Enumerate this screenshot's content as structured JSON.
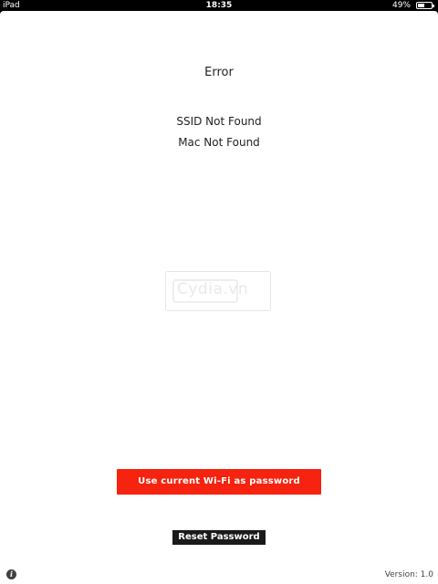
{
  "status_bar": {
    "carrier": "iPad",
    "time": "18:35",
    "battery_percent_label": "49%",
    "battery_level": 0.49
  },
  "main": {
    "title": "Error",
    "ssid_status": "SSID Not Found",
    "mac_status": "Mac Not Found"
  },
  "watermark": {
    "text": "Cydia.vn"
  },
  "buttons": {
    "use_wifi_label": "Use current Wi-Fi as password",
    "reset_label": "Reset Password"
  },
  "footer": {
    "info_icon_glyph": "i",
    "version": "Version: 1.0"
  },
  "colors": {
    "primary_button": "#f5230f",
    "secondary_button": "#1a1a1a"
  }
}
